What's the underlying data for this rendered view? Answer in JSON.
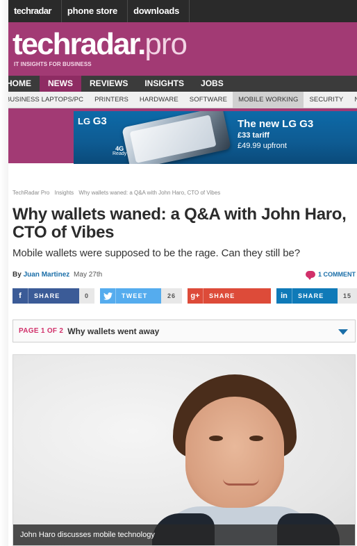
{
  "top_bar": {
    "items": [
      "techradar",
      "phone store",
      "downloads"
    ]
  },
  "brand": {
    "logo_main": "techradar",
    "logo_dot": ".",
    "logo_pro": "pro",
    "tagline": "IT INSIGHTS FOR BUSINESS",
    "color": "#a23a74"
  },
  "main_nav": {
    "items": [
      "HOME",
      "NEWS",
      "REVIEWS",
      "INSIGHTS",
      "JOBS"
    ],
    "active": "NEWS"
  },
  "sub_nav": {
    "items": [
      "BUSINESS LAPTOPS/PC",
      "PRINTERS",
      "HARDWARE",
      "SOFTWARE",
      "MOBILE WORKING",
      "SECURITY",
      "NE"
    ],
    "active": "MOBILE WORKING"
  },
  "ad": {
    "brand": "LG",
    "model": "G3",
    "badge_top": "4G",
    "badge_bottom": "Ready",
    "headline": "The new LG G3",
    "tariff": "£33 tariff",
    "upfront": "£49.99 upfront"
  },
  "breadcrumb": [
    "TechRadar Pro",
    "Insights",
    "Why wallets waned: a Q&A with John Haro, CTO of Vibes"
  ],
  "article": {
    "title": "Why wallets waned: a Q&A with John Haro, CTO of Vibes",
    "subtitle": "Mobile wallets were supposed to be the rage. Can they still be?",
    "by": "By",
    "author": "Juan Martinez",
    "date": "May 27th",
    "comments": "1 COMMENT"
  },
  "share": {
    "facebook": {
      "icon": "f",
      "label": "SHARE",
      "count": "0"
    },
    "twitter": {
      "icon": "♥",
      "label": "TWEET",
      "count": "26"
    },
    "googleplus": {
      "icon": "g+",
      "label": "SHARE"
    },
    "linkedin": {
      "icon": "in",
      "label": "SHARE",
      "count": "15"
    }
  },
  "page_selector": {
    "page": "PAGE 1 OF 2",
    "title": "Why wallets went away"
  },
  "hero": {
    "caption": "John Haro discusses mobile technology"
  },
  "colors": {
    "accent": "#d1306a",
    "link": "#1a6ea8",
    "facebook": "#3b5b97",
    "twitter": "#55acee",
    "googleplus": "#dd4b39",
    "linkedin": "#0f7ab8"
  }
}
